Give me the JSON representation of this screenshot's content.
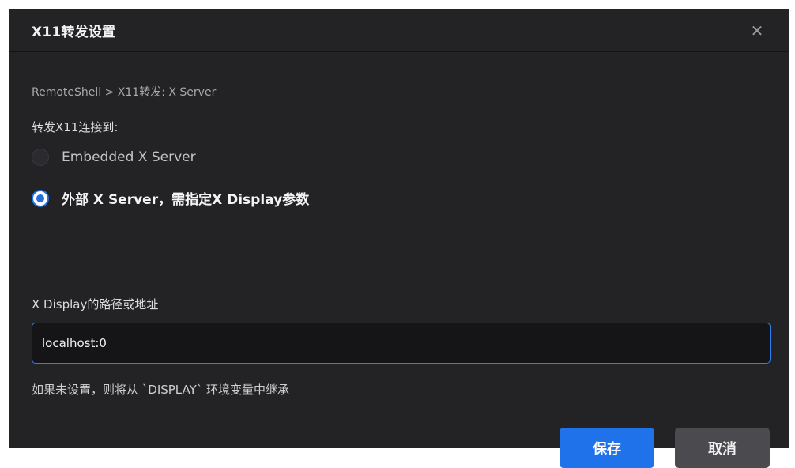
{
  "dialog": {
    "title": "X11转发设置",
    "close_icon": "close-icon",
    "close_glyph": "✕"
  },
  "breadcrumb": "RemoteShell > X11转发: X Server",
  "forward_section": {
    "label": "转发X11连接到:",
    "options": [
      {
        "label": "Embedded X Server",
        "selected": false
      },
      {
        "label": "外部 X Server，需指定X Display参数",
        "selected": true
      }
    ]
  },
  "display_field": {
    "label": "X Display的路径或地址",
    "value": "localhost:0",
    "hint": "如果未设置，则将从 `DISPLAY` 环境变量中继承"
  },
  "buttons": {
    "save": "保存",
    "cancel": "取消"
  },
  "colors": {
    "dialog_bg": "#232326",
    "accent": "#1f72ea",
    "input_border": "#2f7ff0",
    "cancel_bg": "#4a4a4f"
  }
}
